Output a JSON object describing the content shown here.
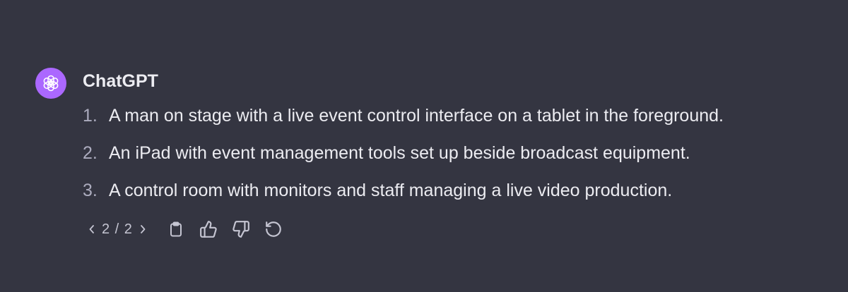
{
  "message": {
    "author": "ChatGPT",
    "items": [
      {
        "num": "1.",
        "text": "A man on stage with a live event control interface on a tablet in the foreground."
      },
      {
        "num": "2.",
        "text": "An iPad with event management tools set up beside broadcast equipment."
      },
      {
        "num": "3.",
        "text": "A control room with monitors and staff managing a live video production."
      }
    ]
  },
  "toolbar": {
    "pager": "2 / 2",
    "icons": [
      "chevron-left-icon",
      "chevron-right-icon",
      "clipboard-icon",
      "thumbs-up-icon",
      "thumbs-down-icon",
      "regenerate-icon"
    ]
  },
  "colors": {
    "background": "#343541",
    "avatar": "#ab68ff",
    "text": "#ececf1",
    "muted": "#acacbe"
  }
}
